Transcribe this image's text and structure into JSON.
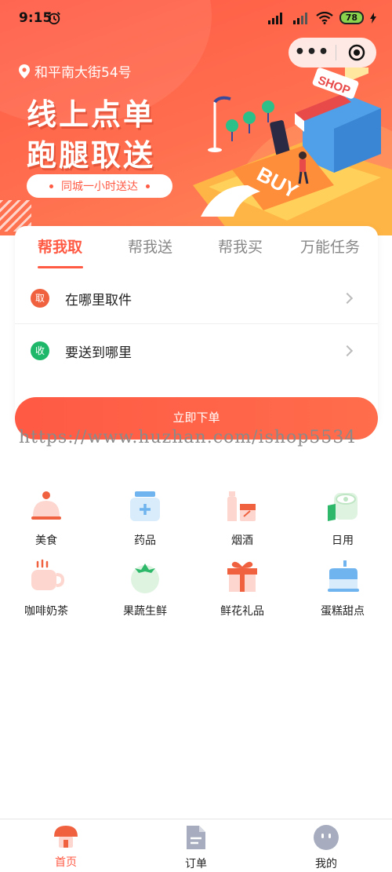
{
  "status_bar": {
    "time": "9:15",
    "battery": "78"
  },
  "location": {
    "address": "和平南大街54号"
  },
  "banner": {
    "headline_line1": "线上点单",
    "headline_line2": "跑腿取送",
    "subtitle": "同城一小时送达",
    "shop_sign": "SHOP",
    "buy_text": "BUY"
  },
  "tabs": [
    {
      "label": "帮我取",
      "active": true
    },
    {
      "label": "帮我送",
      "active": false
    },
    {
      "label": "帮我买",
      "active": false
    },
    {
      "label": "万能任务",
      "active": false
    }
  ],
  "address_rows": [
    {
      "badge": "取",
      "badge_color": "#f0613f",
      "label": "在哪里取件"
    },
    {
      "badge": "收",
      "badge_color": "#1fb86a",
      "label": "要送到哪里"
    }
  ],
  "order_button": {
    "label": "立即下单"
  },
  "watermark": "https://www.huzhan.com/ishop5534",
  "categories": [
    {
      "name": "美食",
      "icon": "food-icon"
    },
    {
      "name": "药品",
      "icon": "medicine-icon"
    },
    {
      "name": "烟酒",
      "icon": "tobacco-wine-icon"
    },
    {
      "name": "日用",
      "icon": "daily-goods-icon"
    },
    {
      "name": "咖啡奶茶",
      "icon": "coffee-tea-icon"
    },
    {
      "name": "果蔬生鲜",
      "icon": "fresh-produce-icon"
    },
    {
      "name": "鲜花礼品",
      "icon": "flower-gift-icon"
    },
    {
      "name": "蛋糕甜点",
      "icon": "cake-dessert-icon"
    }
  ],
  "bottom_nav": [
    {
      "label": "首页",
      "icon": "home-icon",
      "active": true
    },
    {
      "label": "订单",
      "icon": "order-icon",
      "active": false
    },
    {
      "label": "我的",
      "icon": "profile-icon",
      "active": false
    }
  ],
  "colors": {
    "accent": "#ff5a44",
    "green": "#1fb86a"
  }
}
